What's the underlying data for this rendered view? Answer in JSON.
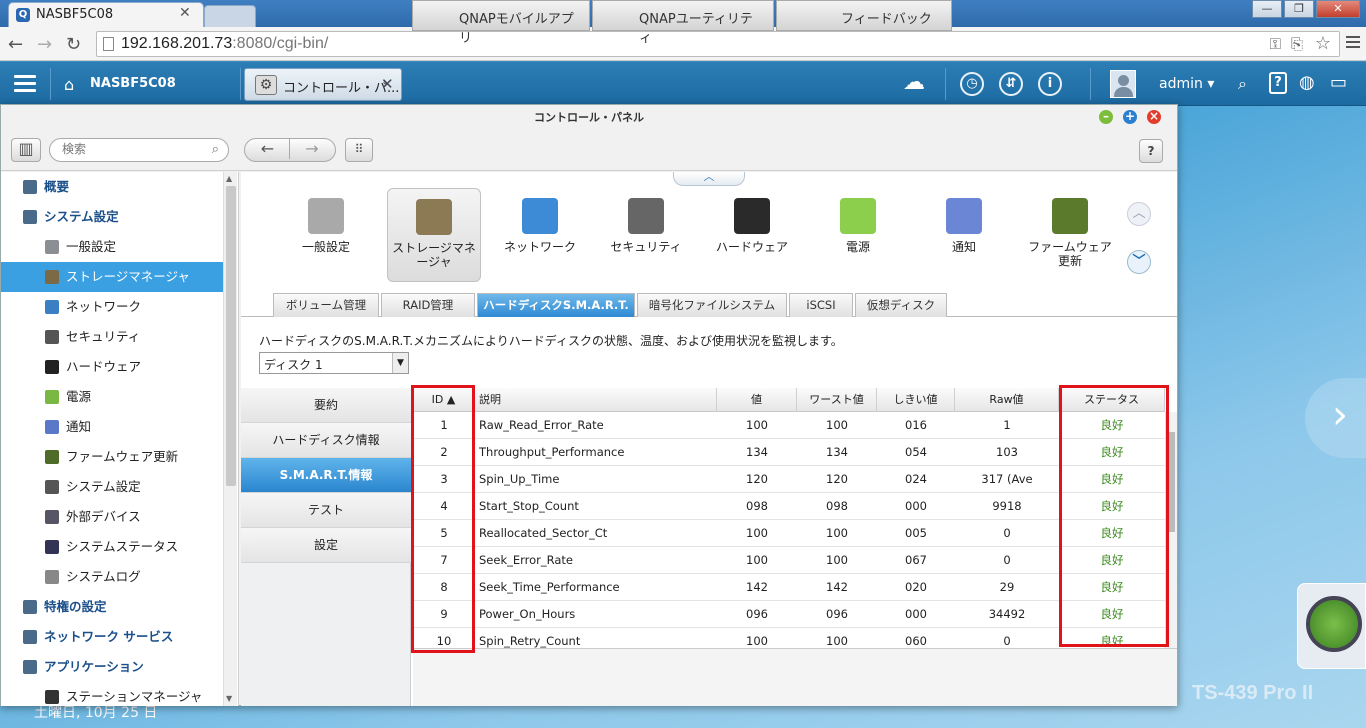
{
  "browser": {
    "tab_title": "NASBF5C08",
    "url_host": "192.168.201.73",
    "url_rest": ":8080/cgi-bin/"
  },
  "qts": {
    "hostname": "NASBF5C08",
    "app_tab": "コントロール・パ...",
    "user": "admin ▾"
  },
  "window": {
    "title": "コントロール・パネル",
    "search_placeholder": "検索"
  },
  "sidenav": [
    {
      "label": "概要",
      "section": true,
      "icon": "overview-icon",
      "color": "#4a6a8a"
    },
    {
      "label": "システム設定",
      "section": true,
      "icon": "gear-icon",
      "color": "#4a6a8a"
    },
    {
      "label": "一般設定",
      "icon": "clipboard-icon",
      "color": "#8b8f94"
    },
    {
      "label": "ストレージマネージャ",
      "icon": "storage-icon",
      "color": "#7b6a45",
      "selected": true
    },
    {
      "label": "ネットワーク",
      "icon": "network-icon",
      "color": "#3a7fc4"
    },
    {
      "label": "セキュリティ",
      "icon": "lock-icon",
      "color": "#555"
    },
    {
      "label": "ハードウェア",
      "icon": "hardware-icon",
      "color": "#222"
    },
    {
      "label": "電源",
      "icon": "bulb-icon",
      "color": "#79b843"
    },
    {
      "label": "通知",
      "icon": "notification-icon",
      "color": "#5a78c8"
    },
    {
      "label": "ファームウェア更新",
      "icon": "firmware-icon",
      "color": "#4f6b2a"
    },
    {
      "label": "システム設定",
      "icon": "system-gear-icon",
      "color": "#555"
    },
    {
      "label": "外部デバイス",
      "icon": "external-device-icon",
      "color": "#556"
    },
    {
      "label": "システムステータス",
      "icon": "monitor-icon",
      "color": "#335"
    },
    {
      "label": "システムログ",
      "icon": "log-icon",
      "color": "#888"
    },
    {
      "label": "特権の設定",
      "section": true,
      "icon": "user-icon",
      "color": "#4a6a8a"
    },
    {
      "label": "ネットワーク サービス",
      "section": true,
      "icon": "globe-icon",
      "color": "#4a6a8a"
    },
    {
      "label": "アプリケーション",
      "section": true,
      "icon": "apps-icon",
      "color": "#4a6a8a"
    },
    {
      "label": "ステーションマネージャ",
      "icon": "station-icon",
      "color": "#333"
    }
  ],
  "icons": [
    {
      "label": "一般設定",
      "icon": "clipboard-icon",
      "color": "#a9a9a9"
    },
    {
      "label": "ストレージマネージャ",
      "icon": "storage-icon",
      "color": "#8c7a55",
      "selected": true
    },
    {
      "label": "ネットワーク",
      "icon": "network-icon",
      "color": "#3d8bd6"
    },
    {
      "label": "セキュリティ",
      "icon": "lock-icon",
      "color": "#666"
    },
    {
      "label": "ハードウェア",
      "icon": "hardware-icon",
      "color": "#2a2a2a"
    },
    {
      "label": "電源",
      "icon": "bulb-icon",
      "color": "#8ccf4d"
    },
    {
      "label": "通知",
      "icon": "notification-icon",
      "color": "#6b86d4"
    },
    {
      "label": "ファームウェア更新",
      "icon": "firmware-icon",
      "color": "#5c7a2c"
    }
  ],
  "subtabs": [
    "ボリューム管理",
    "RAID管理",
    "ハードディスクS.M.A.R.T.",
    "暗号化ファイルシステム",
    "iSCSI",
    "仮想ディスク"
  ],
  "description": "ハードディスクのS.M.A.R.T.メカニズムによりハードディスクの状態、温度、および使用状況を監視します。",
  "disk_select": "ディスク 1",
  "sublist": [
    "要約",
    "ハードディスク情報",
    "S.M.A.R.T.情報",
    "テスト",
    "設定"
  ],
  "table": {
    "headers": [
      "ID ▲",
      "説明",
      "値",
      "ワースト値",
      "しきい値",
      "Raw値",
      "ステータス"
    ],
    "rows": [
      [
        "1",
        "Raw_Read_Error_Rate",
        "100",
        "100",
        "016",
        "1",
        "良好"
      ],
      [
        "2",
        "Throughput_Performance",
        "134",
        "134",
        "054",
        "103",
        "良好"
      ],
      [
        "3",
        "Spin_Up_Time",
        "120",
        "120",
        "024",
        "317 (Ave",
        "良好"
      ],
      [
        "4",
        "Start_Stop_Count",
        "098",
        "098",
        "000",
        "9918",
        "良好"
      ],
      [
        "5",
        "Reallocated_Sector_Ct",
        "100",
        "100",
        "005",
        "0",
        "良好"
      ],
      [
        "7",
        "Seek_Error_Rate",
        "100",
        "100",
        "067",
        "0",
        "良好"
      ],
      [
        "8",
        "Seek_Time_Performance",
        "142",
        "142",
        "020",
        "29",
        "良好"
      ],
      [
        "9",
        "Power_On_Hours",
        "096",
        "096",
        "000",
        "34492",
        "良好"
      ],
      [
        "10",
        "Spin_Retry_Count",
        "100",
        "100",
        "060",
        "0",
        "良好"
      ]
    ]
  },
  "taskbar": [
    "QNAPモバイルアプリ",
    "QNAPユーティリティ",
    "フィードバック"
  ],
  "clock": "土曜日, 10月 25 日",
  "model": "TS-439 Pro II"
}
